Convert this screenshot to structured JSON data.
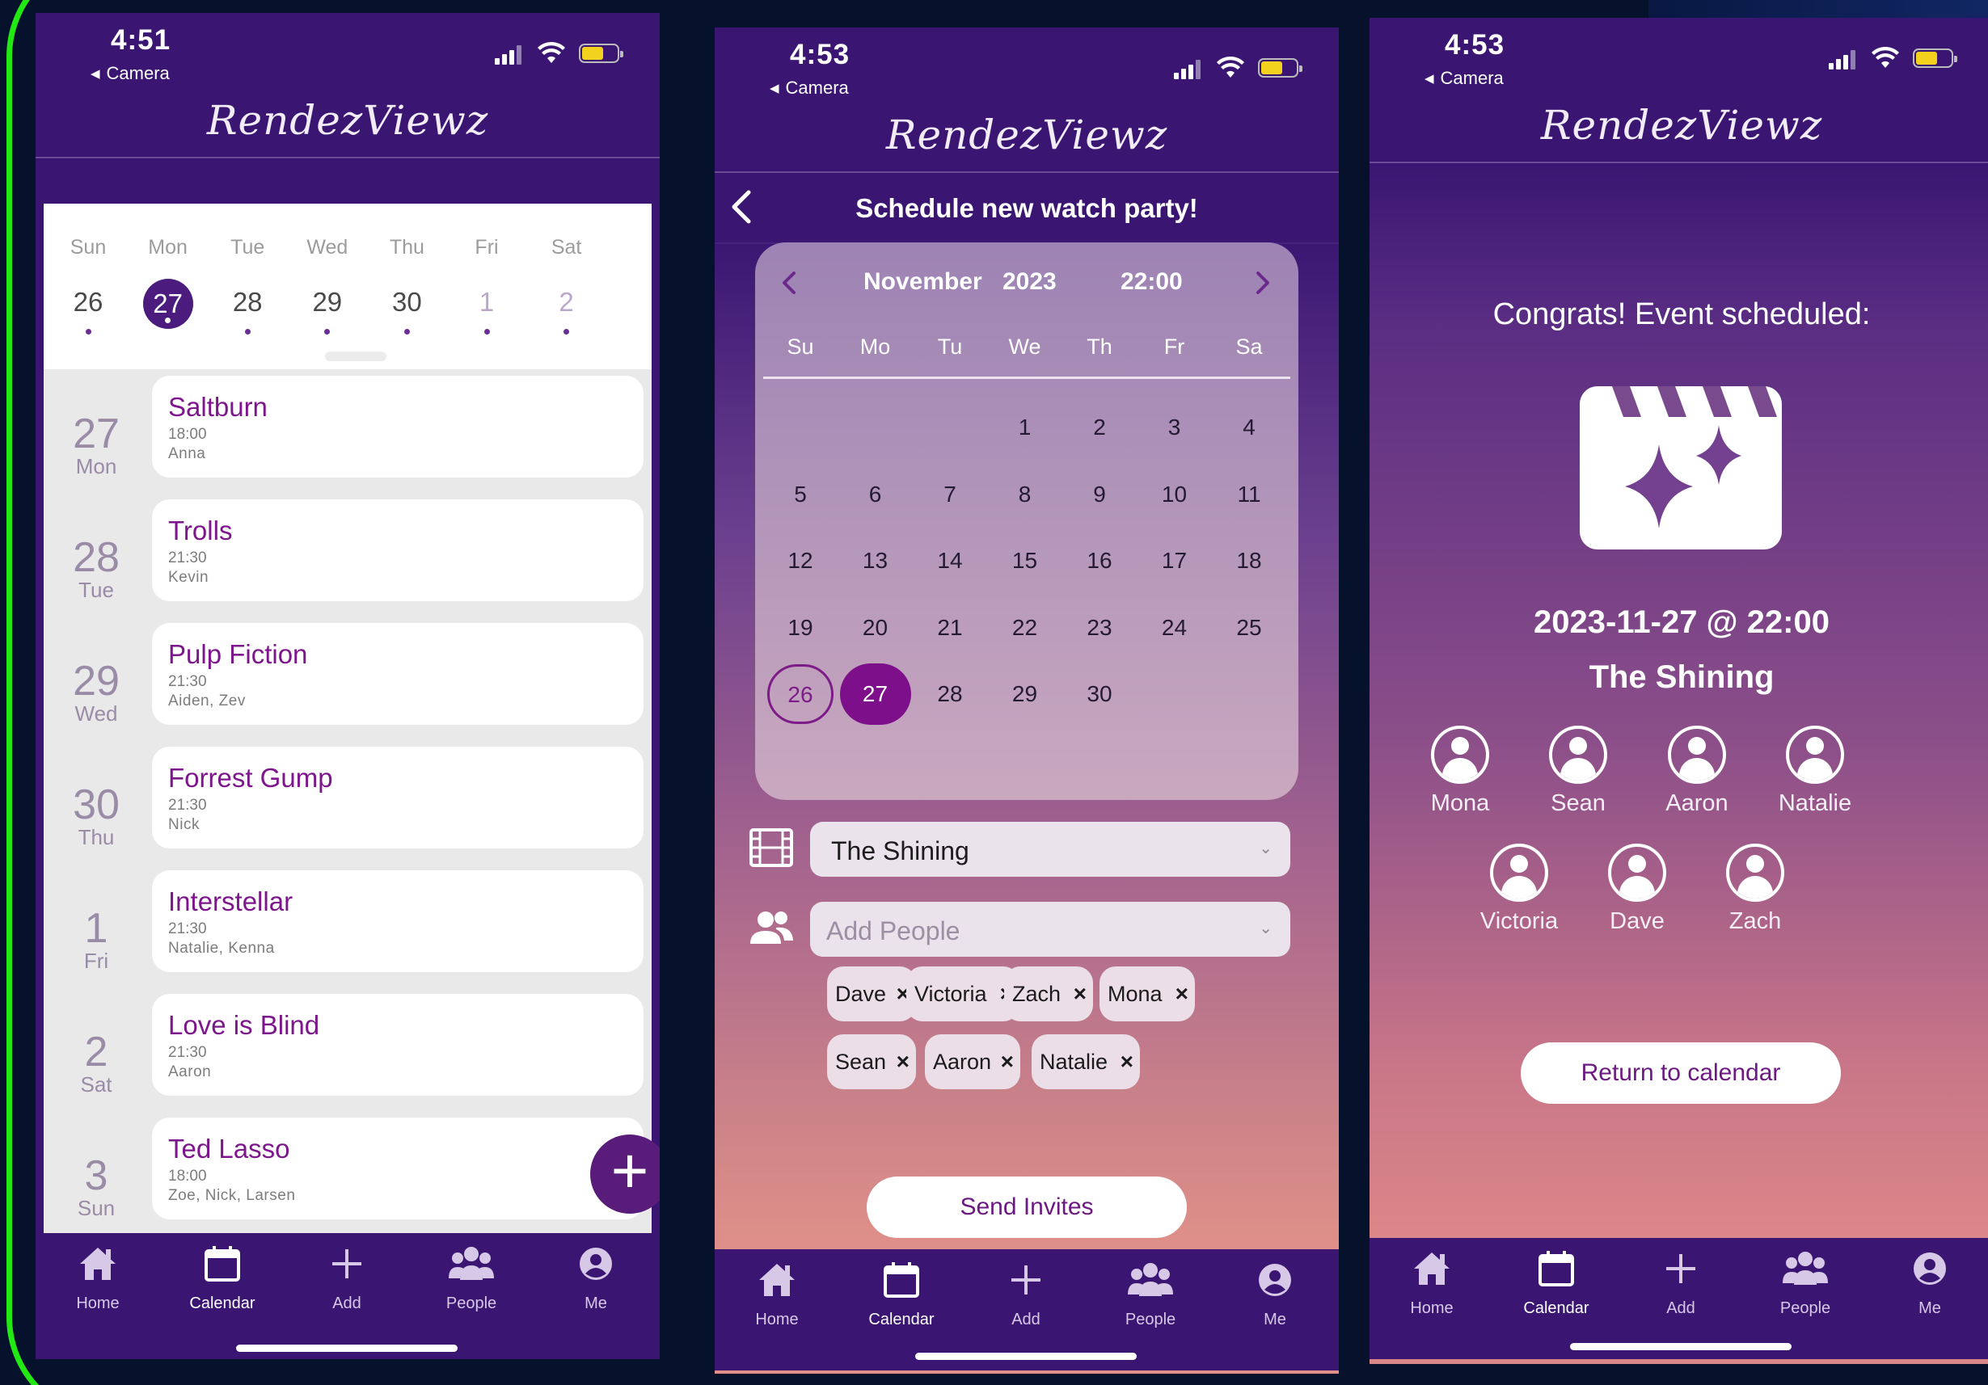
{
  "status_bar": {
    "camera_label": "Camera"
  },
  "brand": {
    "logo_text": "RendezViewz"
  },
  "tabs": [
    "Home",
    "Calendar",
    "Add",
    "People",
    "Me"
  ],
  "screen1": {
    "time": "4:51",
    "week_days": [
      "Sun",
      "Mon",
      "Tue",
      "Wed",
      "Thu",
      "Fri",
      "Sat"
    ],
    "week_dates": [
      "26",
      "27",
      "28",
      "29",
      "30",
      "1",
      "2"
    ],
    "events": [
      {
        "day_num": "27",
        "day_name": "Mon",
        "title": "Saltburn",
        "time": "18:00",
        "people": "Anna"
      },
      {
        "day_num": "28",
        "day_name": "Tue",
        "title": "Trolls",
        "time": "21:30",
        "people": "Kevin"
      },
      {
        "day_num": "29",
        "day_name": "Wed",
        "title": "Pulp Fiction",
        "time": "21:30",
        "people": "Aiden, Zev"
      },
      {
        "day_num": "30",
        "day_name": "Thu",
        "title": "Forrest Gump",
        "time": "21:30",
        "people": "Nick"
      },
      {
        "day_num": "1",
        "day_name": "Fri",
        "title": "Interstellar",
        "time": "21:30",
        "people": "Natalie, Kenna"
      },
      {
        "day_num": "2",
        "day_name": "Sat",
        "title": "Love is Blind",
        "time": "21:30",
        "people": "Aaron"
      },
      {
        "day_num": "3",
        "day_name": "Sun",
        "title": "Ted Lasso",
        "time": "18:00",
        "people": "Zoe, Nick, Larsen"
      }
    ],
    "fab_label": "+"
  },
  "screen2": {
    "time": "4:53",
    "title": "Schedule new watch party!",
    "calendar": {
      "month": "November",
      "year": "2023",
      "time": "22:00",
      "dow": [
        "Su",
        "Mo",
        "Tu",
        "We",
        "Th",
        "Fr",
        "Sa"
      ],
      "days": [
        "1",
        "2",
        "3",
        "4",
        "5",
        "6",
        "7",
        "8",
        "9",
        "10",
        "11",
        "12",
        "13",
        "14",
        "15",
        "16",
        "17",
        "18",
        "19",
        "20",
        "21",
        "22",
        "23",
        "24",
        "25",
        "26",
        "27",
        "28",
        "29",
        "30"
      ],
      "today": "26",
      "selected": "27"
    },
    "movie_value": "The Shining",
    "people_placeholder": "Add People",
    "chips": [
      "Dave",
      "Victoria",
      "Zach",
      "Mona",
      "Sean",
      "Aaron",
      "Natalie"
    ],
    "send_label": "Send Invites"
  },
  "screen3": {
    "time": "4:53",
    "congrats": "Congrats! Event scheduled:",
    "datetime": "2023-11-27 @ 22:00",
    "movie": "The Shining",
    "attendees": [
      "Mona",
      "Sean",
      "Aaron",
      "Natalie",
      "Victoria",
      "Dave",
      "Zach"
    ],
    "return_label": "Return to calendar"
  },
  "colors": {
    "brand_purple": "#3a1672",
    "accent_magenta": "#7d168c",
    "selected_circle": "#4b1b7e"
  }
}
